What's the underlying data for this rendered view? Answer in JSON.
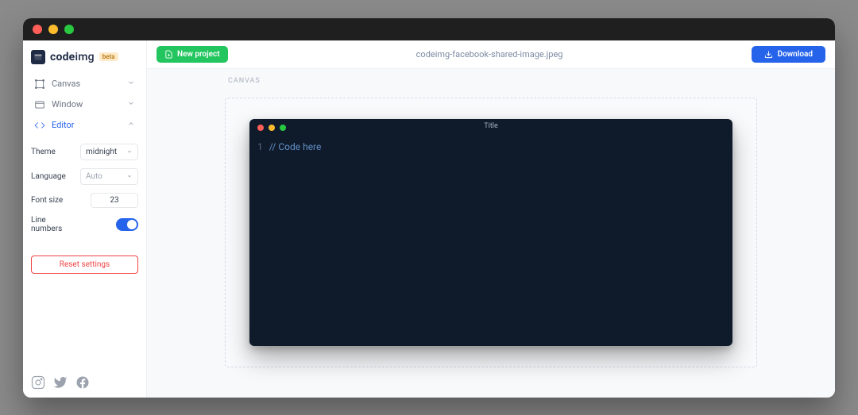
{
  "brand": {
    "name_bold": "code",
    "name_light": "img",
    "badge": "beta"
  },
  "nav": [
    {
      "label": "Canvas",
      "icon": "canvas",
      "active": false,
      "expanded": false
    },
    {
      "label": "Window",
      "icon": "window",
      "active": false,
      "expanded": false
    },
    {
      "label": "Editor",
      "icon": "code",
      "active": true,
      "expanded": true
    }
  ],
  "editor_settings": {
    "theme_label": "Theme",
    "theme_value": "midnight",
    "language_label": "Language",
    "language_value": "Auto",
    "fontsize_label": "Font size",
    "fontsize_value": "23",
    "linenumbers_label": "Line numbers",
    "linenumbers_on": true,
    "reset_label": "Reset settings"
  },
  "topbar": {
    "new_project": "New project",
    "title": "codeimg-facebook-shared-image.jpeg",
    "download": "Download"
  },
  "canvas": {
    "label": "CANVAS",
    "code_window_title": "Title",
    "line_number": "1",
    "code_content": "// Code here"
  }
}
